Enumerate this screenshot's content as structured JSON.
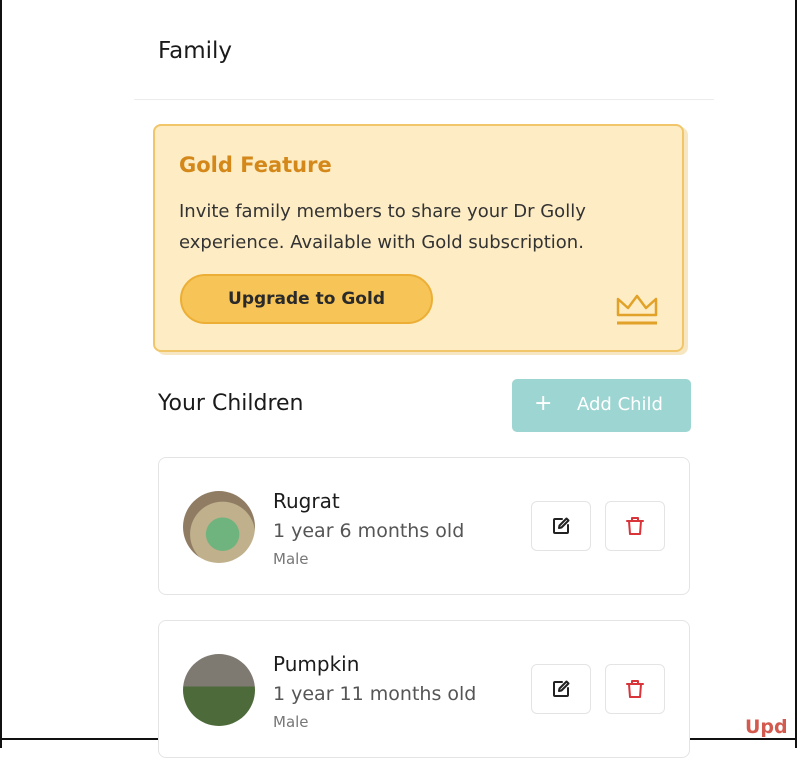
{
  "header": {
    "title": "Family"
  },
  "gold_feature": {
    "title": "Gold Feature",
    "description": "Invite family members to share your Dr Golly experience. Available with Gold subscription.",
    "upgrade_label": "Upgrade to Gold",
    "icon": "crown-icon"
  },
  "children_section": {
    "heading": "Your Children",
    "add_label": "Add Child",
    "add_icon": "+"
  },
  "children": [
    {
      "name": "Rugrat",
      "age": "1 year 6 months old",
      "sex": "Male"
    },
    {
      "name": "Pumpkin",
      "age": "1 year 11 months old",
      "sex": "Male"
    }
  ],
  "footer": {
    "partial_text": "Upd"
  },
  "colors": {
    "gold_title": "#d4881a",
    "gold_bg": "#fdecc4",
    "gold_button": "#f6c457",
    "add_button": "#9dd5d2",
    "delete_icon": "#d8343a"
  }
}
